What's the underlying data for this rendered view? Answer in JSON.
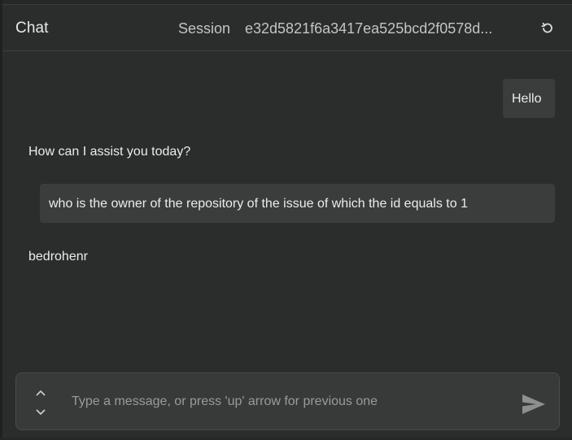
{
  "header": {
    "title": "Chat",
    "session_label": "Session",
    "session_id": "e32d5821f6a3417ea525bcd2f0578d...",
    "reset_icon": "reset-icon"
  },
  "messages": [
    {
      "role": "user",
      "text": "Hello"
    },
    {
      "role": "assistant",
      "text": "How can I assist you today?"
    },
    {
      "role": "user",
      "text": "who is the owner of the repository of the issue of which the id equals to 1"
    },
    {
      "role": "assistant",
      "text": "bedrohenr"
    }
  ],
  "composer": {
    "placeholder": "Type a message, or press 'up' arrow for previous one",
    "value": "",
    "history_icon": "chevron-up-down-icon",
    "send_icon": "send-icon"
  },
  "colors": {
    "background": "#2b2c2c",
    "user_bubble": "#3b3c3c",
    "composer": "#383939",
    "text": "#ececec",
    "muted": "#9a9a9a"
  }
}
